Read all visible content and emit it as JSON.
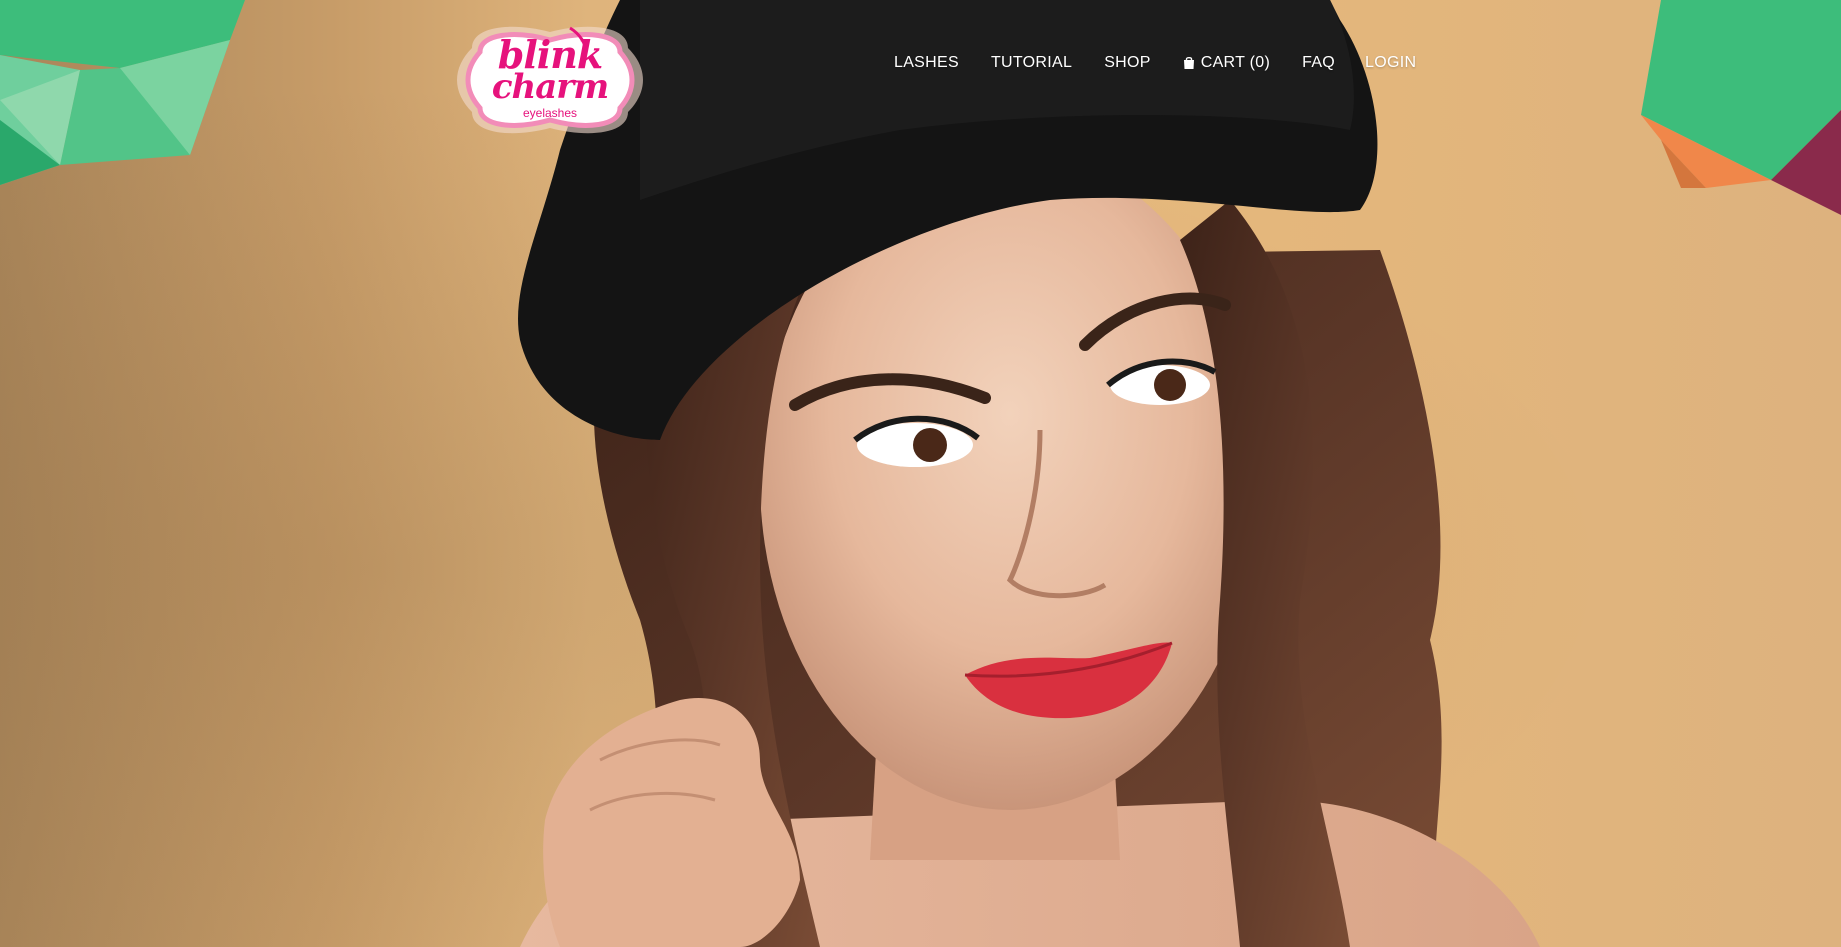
{
  "brand": {
    "logo_line1": "blink",
    "logo_line2": "charm",
    "logo_sub": "eyelashes",
    "color": "#e6127c"
  },
  "nav": {
    "lashes": "LASHES",
    "tutorial": "TUTORIAL",
    "shop": "SHOP",
    "cart": "CART (0)",
    "cart_icon": "shopping-bag-icon",
    "faq": "FAQ",
    "login": "LOGIN"
  },
  "colors": {
    "background": "#e3b67c",
    "accent_green": "#3fbf7a",
    "text": "#ffffff"
  }
}
